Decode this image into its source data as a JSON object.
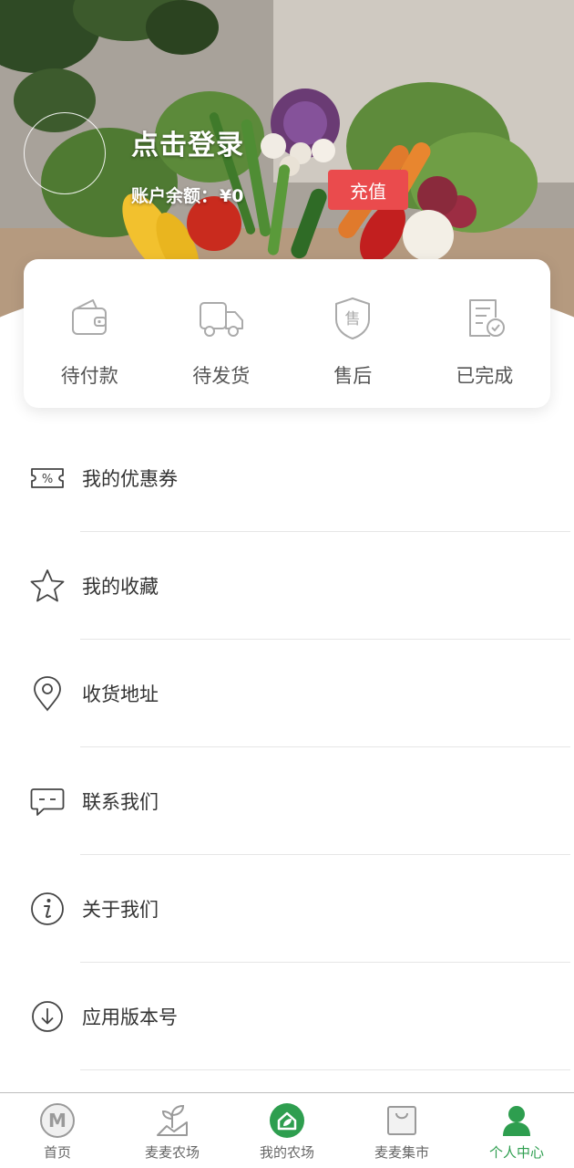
{
  "header": {
    "login_text": "点击登录",
    "balance_label": "账户余额：",
    "balance_value": "¥0",
    "recharge_label": "充值"
  },
  "orders": [
    {
      "label": "待付款",
      "icon": "wallet-icon"
    },
    {
      "label": "待发货",
      "icon": "truck-icon"
    },
    {
      "label": "售后",
      "icon": "after-sale-shield-icon"
    },
    {
      "label": "已完成",
      "icon": "completed-document-icon"
    }
  ],
  "menu": [
    {
      "label": "我的优惠券",
      "icon": "coupon-icon"
    },
    {
      "label": "我的收藏",
      "icon": "star-icon"
    },
    {
      "label": "收货地址",
      "icon": "location-pin-icon"
    },
    {
      "label": "联系我们",
      "icon": "chat-bubble-icon"
    },
    {
      "label": "关于我们",
      "icon": "info-icon"
    },
    {
      "label": "应用版本号",
      "icon": "download-icon"
    }
  ],
  "tabbar": {
    "items": [
      {
        "label": "首页",
        "icon": "home-logo-icon"
      },
      {
        "label": "麦麦农场",
        "icon": "sprout-icon"
      },
      {
        "label": "我的农场",
        "icon": "my-farm-icon"
      },
      {
        "label": "麦麦集市",
        "icon": "shopping-bag-icon"
      },
      {
        "label": "个人中心",
        "icon": "person-icon"
      }
    ],
    "active_index": 4
  },
  "colors": {
    "accent_green": "#2e9e4f",
    "recharge_red": "#ea4b4d"
  }
}
